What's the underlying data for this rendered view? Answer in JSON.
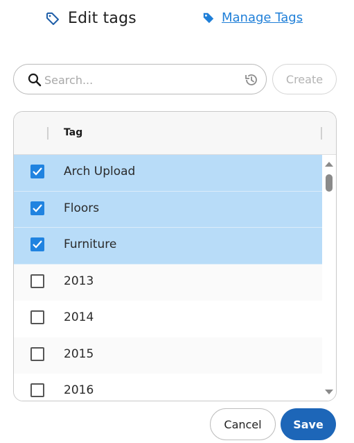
{
  "header": {
    "title": "Edit tags",
    "title_icon": "tag-outline-icon",
    "manage_link": "Manage Tags",
    "manage_icon": "tag-filled-icon"
  },
  "search": {
    "placeholder": "Search...",
    "value": "",
    "search_icon": "search-icon",
    "history_icon": "history-icon"
  },
  "create_label": "Create",
  "table": {
    "header": {
      "tag": "Tag"
    },
    "rows": [
      {
        "label": "Arch Upload",
        "checked": true
      },
      {
        "label": "Floors",
        "checked": true
      },
      {
        "label": "Furniture",
        "checked": true
      },
      {
        "label": "2013",
        "checked": false
      },
      {
        "label": "2014",
        "checked": false
      },
      {
        "label": "2015",
        "checked": false
      },
      {
        "label": "2016",
        "checked": false
      }
    ]
  },
  "footer": {
    "cancel": "Cancel",
    "save": "Save"
  },
  "colors": {
    "accent": "#1f7fd8",
    "selected_row": "#b8dcf8",
    "checkbox": "#2083e0",
    "save_button": "#1d66b8"
  }
}
